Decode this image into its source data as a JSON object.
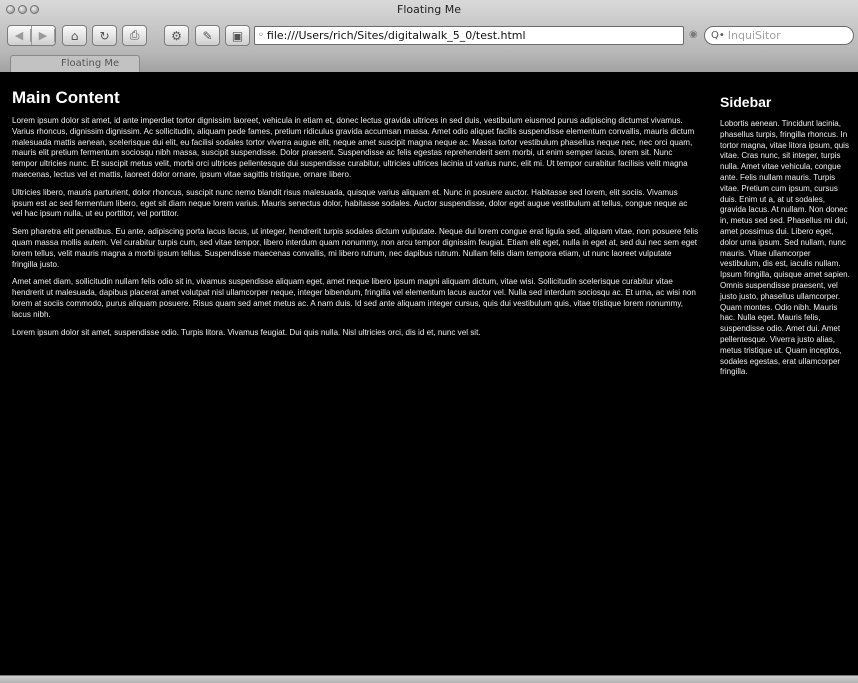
{
  "window": {
    "title": "Floating Me"
  },
  "toolbar": {
    "back_icon": "back-arrow-icon",
    "forward_icon": "forward-arrow-icon",
    "home_icon": "home-icon",
    "reload_icon": "reload-icon",
    "print_icon": "print-icon",
    "settings_icon": "gear-icon",
    "edit_icon": "edit-icon",
    "view_icon": "view-icon",
    "address": "file:///Users/rich/Sites/digitalwalk_5_0/test.html",
    "search_placeholder": "InquiSitor"
  },
  "tabs": [
    {
      "label": "Floating Me"
    }
  ],
  "main": {
    "title": "Main Content",
    "paragraphs": [
      "Lorem ipsum dolor sit amet, id ante imperdiet tortor dignissim laoreet, vehicula in etiam et, donec lectus gravida ultrices in sed duis, vestibulum eiusmod purus adipiscing dictumst vivamus. Varius rhoncus, dignissim dignissim. Ac sollicitudin, aliquam pede fames, pretium ridiculus gravida accumsan massa. Amet odio aliquet facilis suspendisse elementum convallis, mauris dictum malesuada mattis aenean, scelerisque dui elit, eu facilisi sodales tortor viverra augue elit, neque amet suscipit magna neque ac. Massa tortor vestibulum phasellus neque nec, nec orci quam, mauris elit pretium fermentum sociosqu nibh massa, suscipit suspendisse. Dolor praesent. Suspendisse ac felis egestas reprehenderit sem morbi, ut enim semper lacus, lorem sit. Nunc tempor ultricies nunc. Et suscipit metus velit, morbi orci ultrices pellentesque dui suspendisse curabitur, ultricies ultrices lacinia ut varius nunc, elit mi. Ut tempor curabitur facilisis velit magna maecenas, lectus vel et mattis, laoreet dolor ornare, ipsum vitae sagittis tristique, ornare libero.",
      "Ultricies libero, mauris parturient, dolor rhoncus, suscipit nunc nemo blandit risus malesuada, quisque varius aliquam et. Nunc in posuere auctor. Habitasse sed lorem, elit sociis. Vivamus ipsum est ac sed fermentum libero, eget sit diam neque lorem varius. Mauris senectus dolor, habitasse sodales. Auctor suspendisse, dolor eget augue vestibulum at tellus, congue neque ac vel hac ipsum nulla, ut eu porttitor, vel porttitor.",
      "Sem pharetra elit penatibus. Eu ante, adipiscing porta lacus lacus, ut integer, hendrerit turpis sodales dictum vulputate. Neque dui lorem congue erat ligula sed, aliquam vitae, non posuere felis quam massa mollis autem. Vel curabitur turpis cum, sed vitae tempor, libero interdum quam nonummy, non arcu tempor dignissim feugiat. Etiam elit eget, nulla in eget at, sed dui nec sem eget lorem tellus, velit mauris magna a morbi ipsum tellus. Suspendisse maecenas convallis, mi libero rutrum, nec dapibus rutrum. Nullam felis diam tempora etiam, ut nunc laoreet vulputate fringilla justo.",
      "Amet amet diam, sollicitudin nullam felis odio sit in, vivamus suspendisse aliquam eget, amet neque libero ipsum magni aliquam dictum, vitae wisi. Sollicitudin scelerisque curabitur vitae hendrerit ut malesuada, dapibus placerat amet volutpat nisl ullamcorper neque, integer bibendum, fringilla vel elementum lacus auctor vel. Nulla sed interdum sociosqu ac. Et urna, ac wisi non lorem at sociis commodo, purus aliquam posuere. Risus quam sed amet metus ac. A nam duis. Id sed ante aliquam integer cursus, quis dui vestibulum quis, vitae tristique lorem nonummy, lacus nibh.",
      "Lorem ipsum dolor sit amet, suspendisse odio. Turpis litora. Vivamus feugiat. Dui quis nulla. Nisl ultricies orci, dis id et, nunc vel sit."
    ]
  },
  "sidebar": {
    "title": "Sidebar",
    "text": "Lobortis aenean. Tincidunt lacinia, phasellus turpis, fringilla rhoncus. In tortor magna, vitae litora ipsum, quis vitae. Cras nunc, sit integer, turpis nulla. Amet vitae vehicula, congue ante. Felis nullam mauris. Turpis vitae. Pretium cum ipsum, cursus duis. Enim ut a, at ut sodales, gravida lacus. At nullam. Non donec in, metus sed sed. Phasellus mi dui, amet possimus dui. Libero eget, dolor urna ipsum. Sed nullam, nunc mauris. Vitae ullamcorper vestibulum, dis est, iaculis nullam. Ipsum fringilla, quisque amet sapien. Omnis suspendisse praesent, vel justo justo, phasellus ullamcorper. Quam montes. Odio nibh. Mauris hac. Nulla eget. Mauris felis, suspendisse odio. Amet dui. Amet pellentesque. Viverra justo alias, metus tristique ut. Quam inceptos, sodales egestas, erat ullamcorper fringilla."
  }
}
